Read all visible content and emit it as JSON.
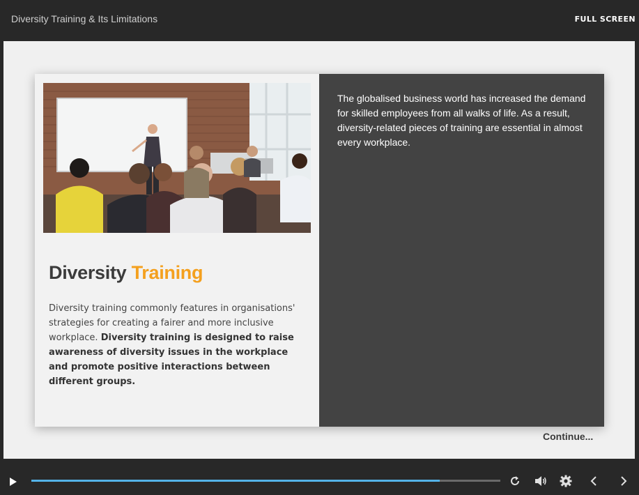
{
  "header": {
    "course_title": "Diversity Training & Its Limitations",
    "fullscreen_label": "FULL SCREEN"
  },
  "slide": {
    "heading_primary": "Diversity",
    "heading_accent": "Training",
    "body_plain": "Diversity training commonly features in organisations' strategies for creating a fairer and more inclusive workplace. ",
    "body_bold": "Diversity training is designed to raise awareness of diversity issues in the workplace and promote positive interactions between different groups.",
    "right_text": "The globalised business world has increased the demand for skilled employees from all walks of life. As a result, diversity-related pieces of training are essential in almost every workplace.",
    "image_description_icon": "photo-presentation-meeting",
    "continue_label": "Continue..."
  },
  "player": {
    "progress": 0.871,
    "controls": {
      "play_icon": "play-icon",
      "replay_icon": "replay-icon",
      "volume_icon": "volume-icon",
      "settings_icon": "gear-icon",
      "prev_icon": "chevron-left-icon",
      "next_icon": "chevron-right-icon"
    }
  },
  "colors": {
    "accent": "#f4a01e",
    "progress": "#54b3e8",
    "panel_dark": "#434343",
    "chrome": "#282828"
  }
}
